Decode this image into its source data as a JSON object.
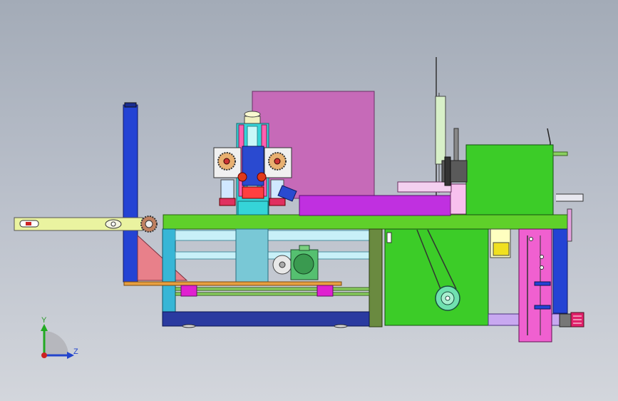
{
  "view": {
    "title": "",
    "background_top": "#a3abb7",
    "background_bottom": "#d3d6dc"
  },
  "triad": {
    "y_label": "Y",
    "z_label": "Z",
    "y_color": "#22aa22",
    "z_color": "#2244cc",
    "origin_color": "#cc2222"
  },
  "model": {
    "description_icon": "machine-assembly-icon",
    "colors": {
      "frame_green": "#5fd02a",
      "cyan_leg": "#37b6d6",
      "blue_column": "#2443d4",
      "magenta_panel": "#c66ab8",
      "purple_bed": "#c030e0",
      "green_box": "#3ccc28",
      "pink_cabinet": "#f060d0",
      "yellow_arm": "#eaf3a0",
      "navy_base": "#2a3aa0"
    }
  }
}
